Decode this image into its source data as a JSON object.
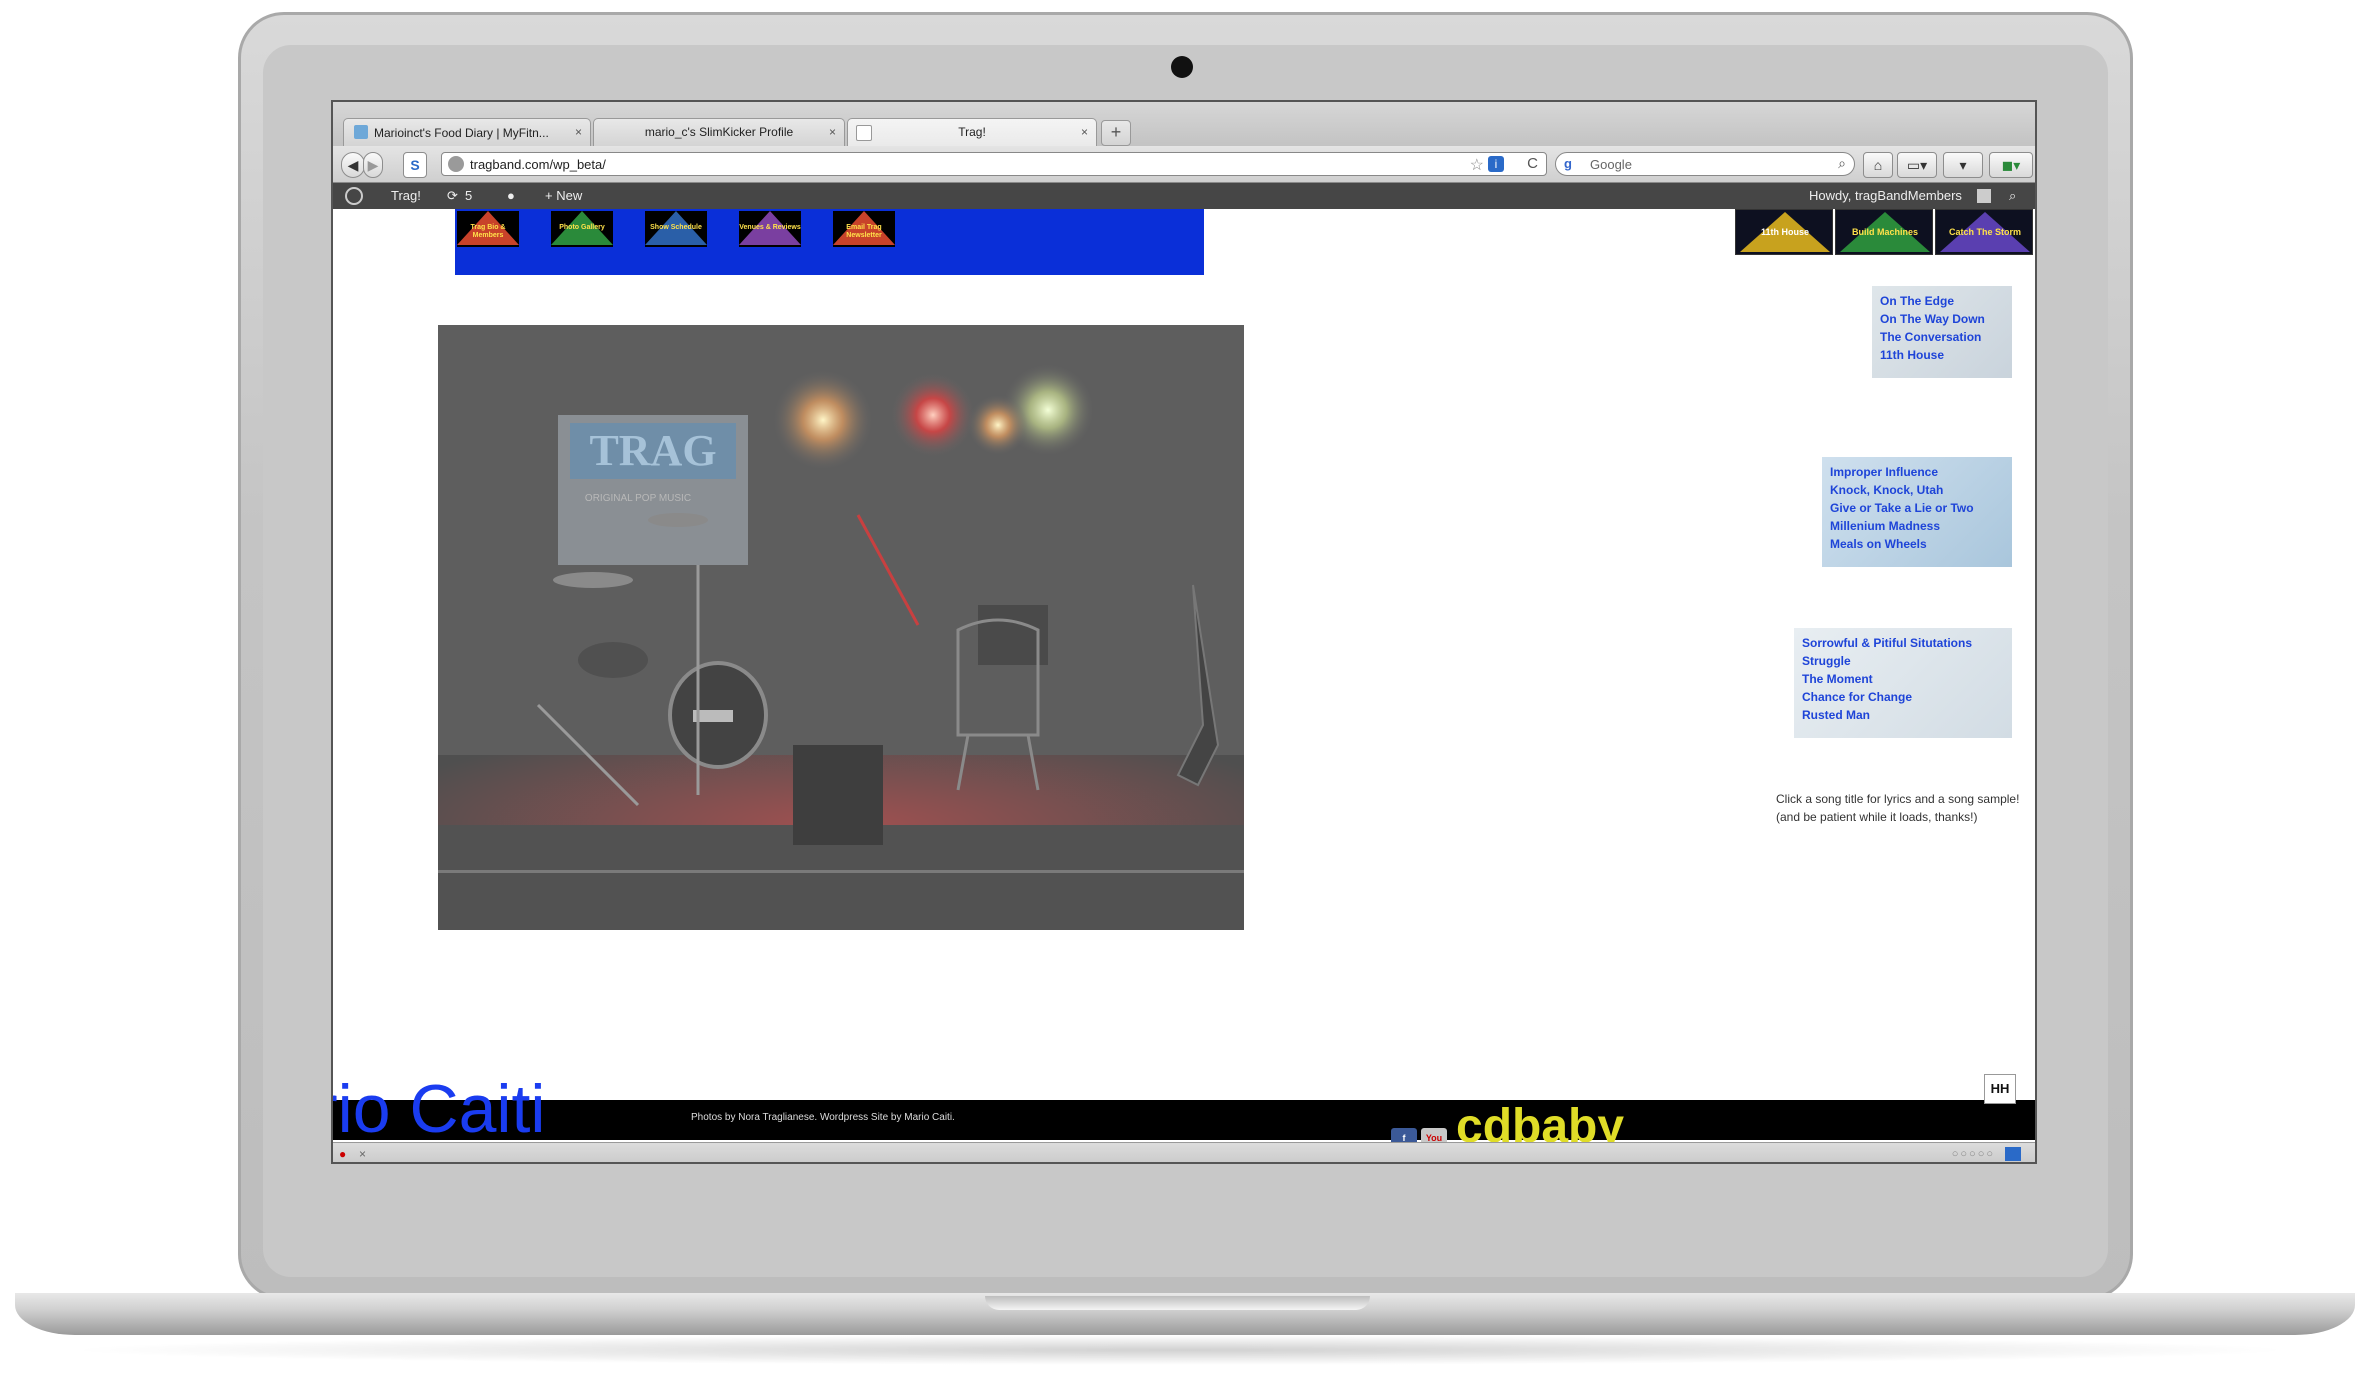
{
  "browser": {
    "tabs": [
      {
        "label": "Marioinct's Food Diary | MyFitn...",
        "favicon_color": "#6ea8d8"
      },
      {
        "label": "mario_c's SlimKicker Profile",
        "favicon_color": "#cccccc"
      },
      {
        "label": "Trag!",
        "favicon_color": "#ffffff"
      }
    ],
    "new_tab_label": "+",
    "close_label": "×",
    "back_label": "◀",
    "forward_label": "▶",
    "url": "tragband.com/wp_beta/",
    "search_placeholder": "Google",
    "search_engine_label": "g",
    "star_label": "☆",
    "info_label": "i",
    "reload_label": "C"
  },
  "wp_admin_bar": {
    "site_name": "Trag!",
    "updates_count": "5",
    "new_label": "+ New",
    "greeting": "Howdy, tragBandMembers"
  },
  "site_nav": {
    "left_items": [
      {
        "label": "Trag Bio & Members",
        "color": "#c8422a",
        "text_color": "#ffe24a"
      },
      {
        "label": "Photo Gallery",
        "color": "#2a8a3a",
        "text_color": "#ffe24a"
      },
      {
        "label": "Show Schedule",
        "color": "#2a5fa8",
        "text_color": "#ffe24a"
      },
      {
        "label": "Venues & Reviews",
        "color": "#7a3fa0",
        "text_color": "#ffe24a"
      },
      {
        "label": "Email Trag Newsletter",
        "color": "#c8422a",
        "text_color": "#ffe24a"
      }
    ],
    "right_items": [
      {
        "label": "11th House",
        "color": "#c8a21e",
        "text_color": "#ffffff"
      },
      {
        "label": "Build Machines",
        "color": "#2a8a3a",
        "text_color": "#ffe24a"
      },
      {
        "label": "Catch The Storm",
        "color": "#5a3fb0",
        "text_color": "#ffe24a"
      }
    ]
  },
  "photo": {
    "banner_text": "TRAG",
    "banner_subtitle": "ORIGINAL POP MUSIC"
  },
  "albums": [
    {
      "songs": [
        "On The Edge",
        "On The Way Down",
        "The Conversation",
        "11th House"
      ]
    },
    {
      "songs": [
        "Improper Influence",
        "Knock, Knock, Utah",
        "Give or Take a Lie or Two",
        "Millenium Madness",
        "Meals on Wheels"
      ]
    },
    {
      "songs": [
        "Sorrowful & Pitiful Situtations",
        "Struggle",
        "The Moment",
        "Chance for Change",
        "Rusted Man"
      ]
    }
  ],
  "note": {
    "line1": "Click a song title for lyrics and a song sample!",
    "line2": "(and be patient while it loads, thanks!)"
  },
  "footer": {
    "credit": "Photos by Nora Traglianese. Wordpress Site by Mario Caiti.",
    "big_name": "rio Caiti",
    "cdbaby": "cdbaby",
    "hh_badge": "HH"
  },
  "colors": {
    "blue_header": "#0a2fd8",
    "song_link": "#1e44d8"
  }
}
